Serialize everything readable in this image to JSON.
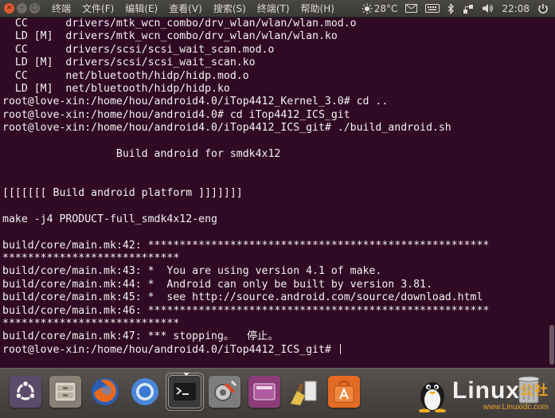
{
  "topbar": {
    "window_controls": [
      "×",
      "−",
      "□"
    ],
    "menu": [
      "终端",
      "文件(F)",
      "编辑(E)",
      "查看(V)",
      "搜索(S)",
      "终端(T)",
      "帮助(H)"
    ],
    "weather": "28°C",
    "clock": "22:08",
    "icons": [
      "weather-sun-icon",
      "mail-icon",
      "keyboard-icon",
      "bluetooth-icon",
      "network-icon",
      "volume-icon",
      "power-icon"
    ]
  },
  "terminal": {
    "background": "#300a24",
    "foreground": "#f2f2f2",
    "lines": [
      "  CC      drivers/mtk_wcn_combo/drv_wlan/wlan/wlan.mod.o",
      "  LD [M]  drivers/mtk_wcn_combo/drv_wlan/wlan/wlan.ko",
      "  CC      drivers/scsi/scsi_wait_scan.mod.o",
      "  LD [M]  drivers/scsi/scsi_wait_scan.ko",
      "  CC      net/bluetooth/hidp/hidp.mod.o",
      "  LD [M]  net/bluetooth/hidp/hidp.ko",
      "root@love-xin:/home/hou/android4.0/iTop4412_Kernel_3.0# cd ..",
      "root@love-xin:/home/hou/android4.0# cd iTop4412_ICS_git",
      "root@love-xin:/home/hou/android4.0/iTop4412_ICS_git# ./build_android.sh",
      "",
      "                  Build android for smdk4x12",
      "",
      "",
      "[[[[[[[ Build android platform ]]]]]]]",
      "",
      "make -j4 PRODUCT-full_smdk4x12-eng",
      "",
      "build/core/main.mk:42: ******************************************************",
      "****************************",
      "build/core/main.mk:43: *  You are using version 4.1 of make.",
      "build/core/main.mk:44: *  Android can only be built by version 3.81.",
      "build/core/main.mk:45: *  see http://source.android.com/source/download.html",
      "build/core/main.mk:46: ******************************************************",
      "****************************",
      "build/core/main.mk:47: *** stopping。  停止。",
      "root@love-xin:/home/hou/android4.0/iTop4412_ICS_git# "
    ]
  },
  "dock": {
    "launchers": [
      {
        "name": "ubuntu-dash",
        "icon": "ubuntu-logo-icon",
        "color": "#6e5f7a"
      },
      {
        "name": "files",
        "icon": "file-cabinet-icon",
        "color": "#8a7f75"
      },
      {
        "name": "firefox",
        "icon": "firefox-icon",
        "color": "#e2671c"
      },
      {
        "name": "chromium",
        "icon": "chromium-icon",
        "color": "#3d7bd8"
      },
      {
        "name": "terminal",
        "icon": "terminal-icon",
        "color": "#2e2e2e"
      },
      {
        "name": "system-settings",
        "icon": "settings-icon",
        "color": "#8c8c8c"
      },
      {
        "name": "workspace-switcher",
        "icon": "workspaces-icon",
        "color": "#8c3d7a"
      },
      {
        "name": "cleaner",
        "icon": "broom-icon",
        "color": "#d0b24a"
      },
      {
        "name": "software-center",
        "icon": "software-center-icon",
        "color": "#e46b25"
      },
      {
        "name": "trash",
        "icon": "trash-icon",
        "color": "#9a9a9a"
      }
    ]
  },
  "watermark": {
    "big": "Linux",
    "suffix": "公社",
    "url": "www.Linuxidc.com"
  }
}
